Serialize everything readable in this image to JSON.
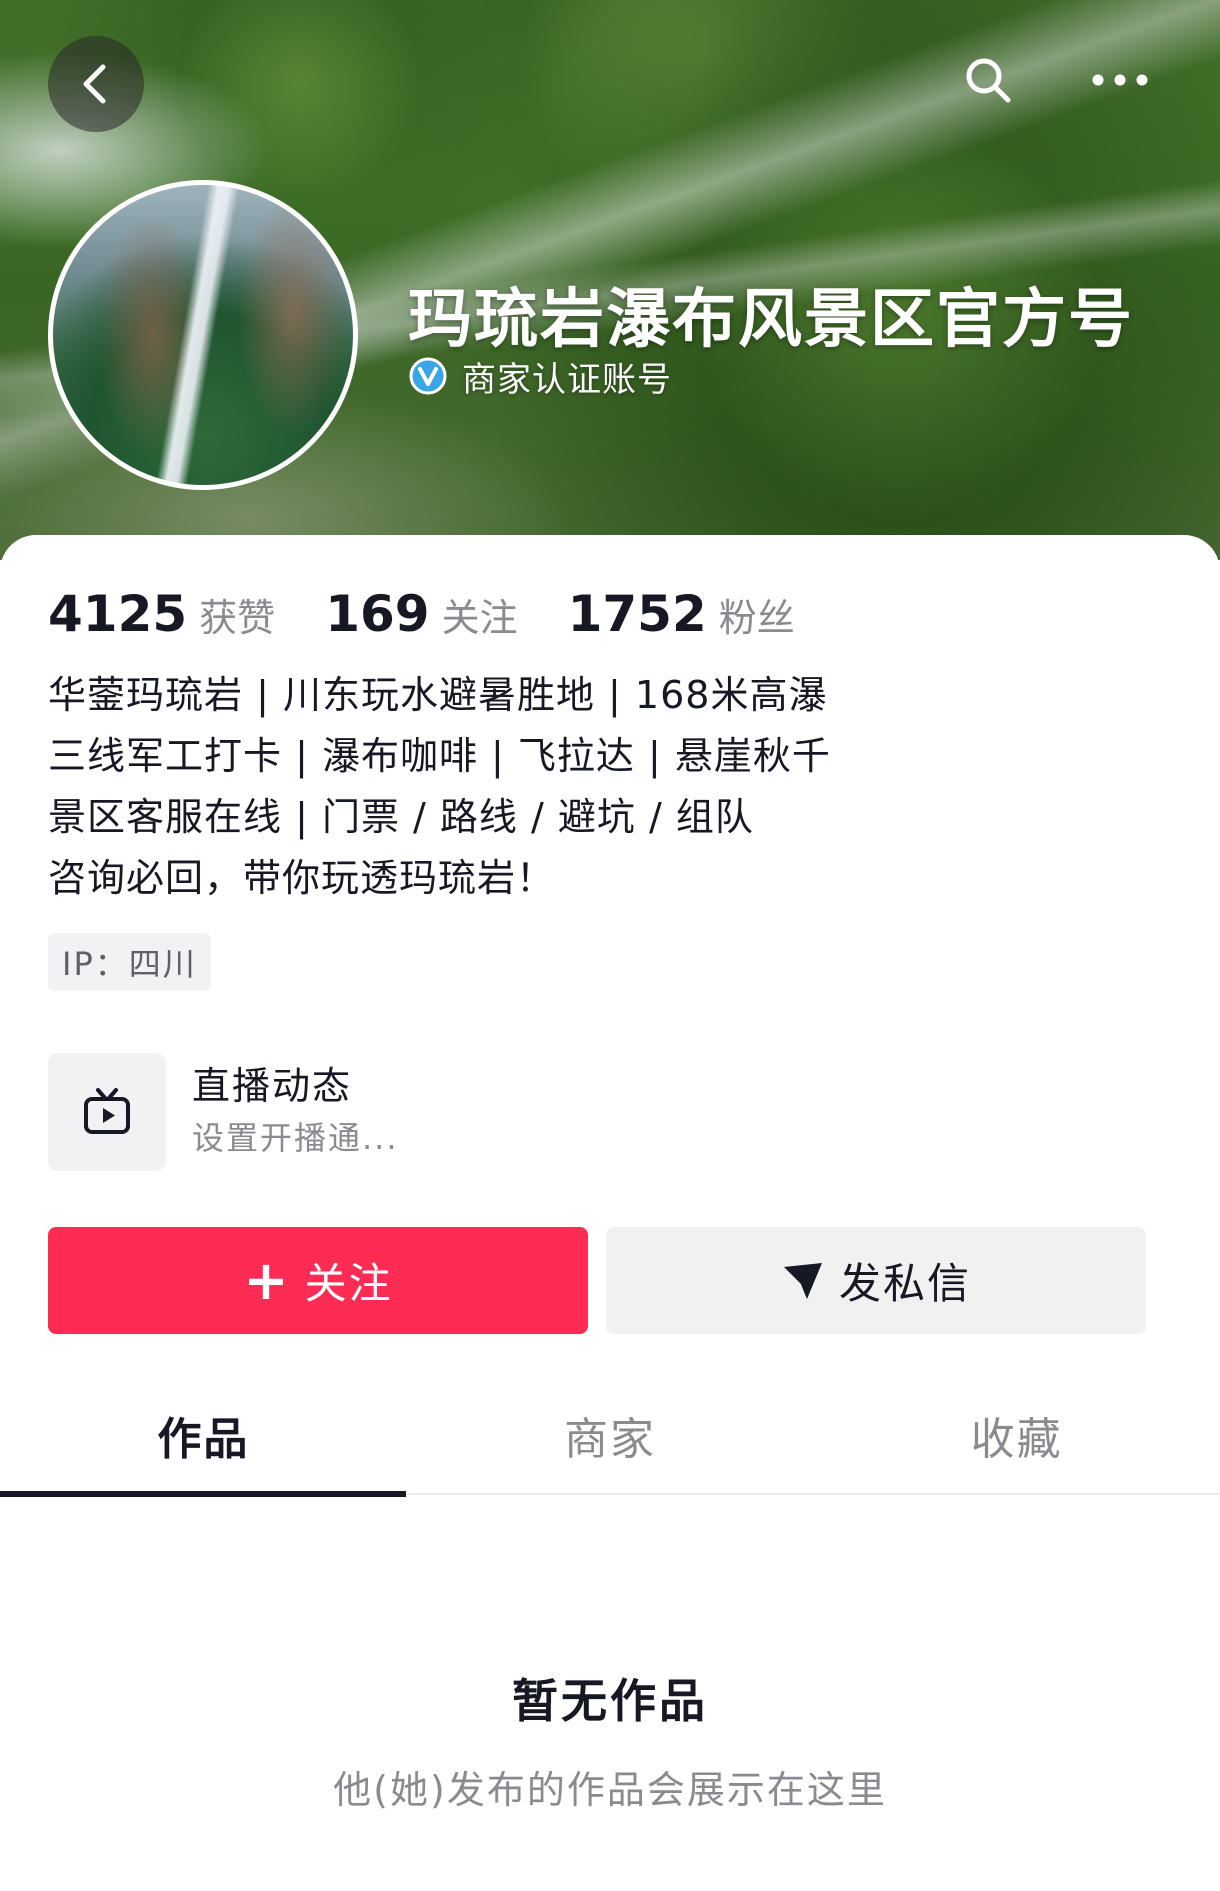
{
  "header": {
    "title": "玛琉岩瀑布风景区官方号",
    "verified_label": "商家认证账号"
  },
  "stats": [
    {
      "value": "4125",
      "label": "获赞"
    },
    {
      "value": "169",
      "label": "关注"
    },
    {
      "value": "1752",
      "label": "粉丝"
    }
  ],
  "bio": [
    "华蓥玛琉岩 | 川东玩水避暑胜地 | 168米高瀑",
    "三线军工打卡 | 瀑布咖啡 | 飞拉达 | 悬崖秋千",
    "景区客服在线 | 门票 / 路线 / 避坑 / 组队",
    "咨询必回，带你玩透玛琉岩！"
  ],
  "ip_tag": "IP：四川",
  "live": {
    "title": "直播动态",
    "subtitle": "设置开播通..."
  },
  "actions": {
    "follow_plus": "+",
    "follow_label": "关注",
    "message_label": "发私信"
  },
  "tabs": [
    {
      "label": "作品",
      "active": true
    },
    {
      "label": "商家",
      "active": false
    },
    {
      "label": "收藏",
      "active": false
    }
  ],
  "empty_state": {
    "title": "暂无作品",
    "subtitle": "他(她)发布的作品会展示在这里"
  },
  "colors": {
    "accent": "#fe2c55",
    "text_primary": "#161823",
    "text_secondary": "#8a8b91",
    "verified_blue": "#3aa6e8"
  },
  "icons": {
    "back": "chevron-left-icon",
    "search": "search-icon",
    "more": "more-horizontal-icon",
    "verified": "verified-badge-icon",
    "live": "tv-play-icon",
    "message": "send-icon"
  }
}
